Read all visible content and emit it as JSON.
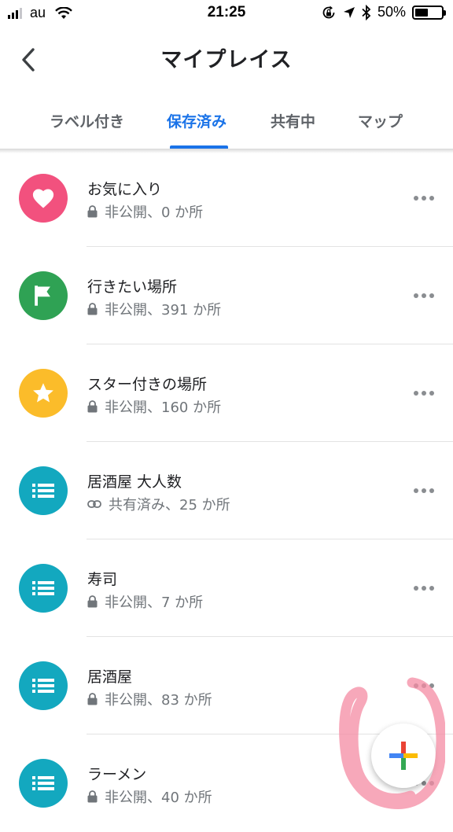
{
  "status_bar": {
    "carrier": "au",
    "time": "21:25",
    "battery": "50%",
    "battery_level": 0.5
  },
  "header": {
    "title": "マイプレイス",
    "back_icon": "chevron-left-icon"
  },
  "tabs": [
    {
      "label": "ラベル付き",
      "active": false
    },
    {
      "label": "保存済み",
      "active": true
    },
    {
      "label": "共有中",
      "active": false
    },
    {
      "label": "マップ",
      "active": false
    }
  ],
  "lists": [
    {
      "title": "お気に入り",
      "subtitle": "非公開、0 か所",
      "icon": "heart-icon",
      "color": "#f2517e",
      "privacy": "lock-icon"
    },
    {
      "title": "行きたい場所",
      "subtitle": "非公開、391 か所",
      "icon": "flag-icon",
      "color": "#2fa254",
      "privacy": "lock-icon"
    },
    {
      "title": "スター付きの場所",
      "subtitle": "非公開、160 か所",
      "icon": "star-icon",
      "color": "#fbbc2a",
      "privacy": "lock-icon"
    },
    {
      "title": "居酒屋 大人数",
      "subtitle": "共有済み、25 か所",
      "icon": "list-icon",
      "color": "#13a8bf",
      "privacy": "link-icon"
    },
    {
      "title": "寿司",
      "subtitle": "非公開、7 か所",
      "icon": "list-icon",
      "color": "#13a8bf",
      "privacy": "lock-icon"
    },
    {
      "title": "居酒屋",
      "subtitle": "非公開、83 か所",
      "icon": "list-icon",
      "color": "#13a8bf",
      "privacy": "lock-icon"
    },
    {
      "title": "ラーメン",
      "subtitle": "非公開、40 か所",
      "icon": "list-icon",
      "color": "#13a8bf",
      "privacy": "lock-icon"
    }
  ],
  "fab": {
    "icon": "plus-icon"
  },
  "colors": {
    "accent": "#1a73e8",
    "annotation": "#f48ba3"
  }
}
